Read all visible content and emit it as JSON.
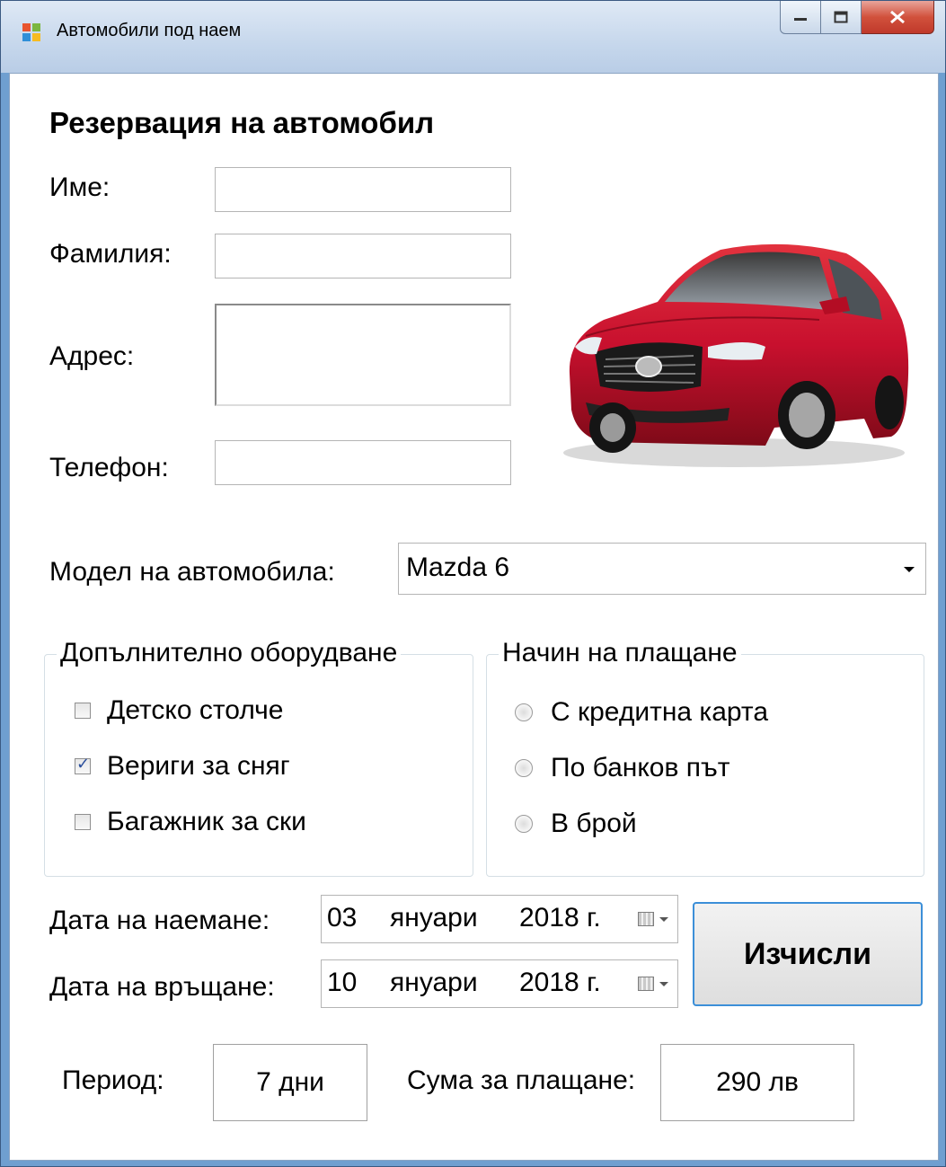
{
  "window": {
    "title": "Автомобили под наем",
    "controls": {
      "minimize": "minimize-icon",
      "maximize": "maximize-icon",
      "close": "close-icon"
    }
  },
  "form": {
    "heading": "Резервация на автомобил",
    "fields": {
      "first_name": {
        "label": "Име:",
        "value": ""
      },
      "last_name": {
        "label": "Фамилия:",
        "value": ""
      },
      "address": {
        "label": "Адрес:",
        "value": ""
      },
      "phone": {
        "label": "Телефон:",
        "value": ""
      }
    },
    "car_model": {
      "label": "Модел на автомобила:",
      "selected": "Mazda 6"
    },
    "equipment": {
      "title": "Допълнително оборудване",
      "items": [
        {
          "label": "Детско столче",
          "checked": false
        },
        {
          "label": "Вериги за сняг",
          "checked": true
        },
        {
          "label": "Багажник за ски",
          "checked": false
        }
      ]
    },
    "payment": {
      "title": "Начин на плащане",
      "options": [
        {
          "label": "С кредитна карта",
          "selected": false
        },
        {
          "label": "По банков път",
          "selected": false
        },
        {
          "label": "В брой",
          "selected": false
        }
      ]
    },
    "rent_date": {
      "label": "Дата на наемане:",
      "day": "03",
      "month": "януари",
      "year": "2018 г."
    },
    "return_date": {
      "label": "Дата на връщане:",
      "day": "10",
      "month": "януари",
      "year": "2018 г."
    },
    "calculate_button": "Изчисли",
    "period": {
      "label": "Период:",
      "value": "7 дни"
    },
    "total": {
      "label": "Сума за плащане:",
      "value": "290 лв"
    }
  },
  "colors": {
    "window_frame": "#6f9fd0",
    "close_button": "#c0392b",
    "button_focus_border": "#3c8fd8",
    "car_red": "#c8102e"
  }
}
